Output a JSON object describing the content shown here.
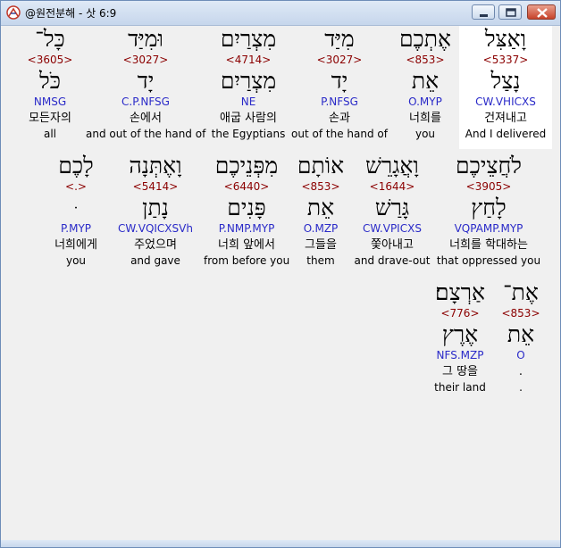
{
  "window": {
    "title": "@원전분해 - 삿 6:9",
    "controls": {
      "minimize": "minimize-icon",
      "maximize": "maximize-icon",
      "close": "close-icon"
    }
  },
  "rows": [
    [
      {
        "hebrew": "וָאַצִּל",
        "strong": "<5337>",
        "lemma": "נָצַל",
        "morph": "CW.VHICXS",
        "korean": "건져내고",
        "english": "And I delivered",
        "highlight": true
      },
      {
        "hebrew": "אֶתְכֶם",
        "strong": "<853>",
        "lemma": "אֵת",
        "morph": "O.MYP",
        "korean": "너희를",
        "english": "you"
      },
      {
        "hebrew": "מִיַּד",
        "strong": "<3027>",
        "lemma": "יָד",
        "morph": "P.NFSG",
        "korean": "손과",
        "english": "out of the hand of"
      },
      {
        "hebrew": "מִצְרַיִם",
        "strong": "<4714>",
        "lemma": "מִצְרַיִם",
        "morph": "NE",
        "korean": "애굽 사람의",
        "english": "the Egyptians"
      },
      {
        "hebrew": "וּמִיַּד",
        "strong": "<3027>",
        "lemma": "יָד",
        "morph": "C.P.NFSG",
        "korean": "손에서",
        "english": "and out of the hand of"
      },
      {
        "hebrew": "כָּל־",
        "strong": "<3605>",
        "lemma": "כֹּל",
        "morph": "NMSG",
        "korean": "모든자의",
        "english": "all"
      }
    ],
    [
      {
        "hebrew": "לֹחֲצֵיכֶם",
        "strong": "<3905>",
        "lemma": "לָחַץ",
        "morph": "VQPAMP.MYP",
        "korean": "너희를 학대하는",
        "english": "that oppressed you"
      },
      {
        "hebrew": "וָאֲגָרֵשׁ",
        "strong": "<1644>",
        "lemma": "גָּרַשׁ",
        "morph": "CW.VPICXS",
        "korean": "쫓아내고",
        "english": "and drave-out"
      },
      {
        "hebrew": "אוֹתָם",
        "strong": "<853>",
        "lemma": "אֵת",
        "morph": "O.MZP",
        "korean": "그들을",
        "english": "them"
      },
      {
        "hebrew": "מִפְּנֵיכֶם",
        "strong": "<6440>",
        "lemma": "פָּנִים",
        "morph": "P.NMP.MYP",
        "korean": "너희 앞에서",
        "english": "from before you"
      },
      {
        "hebrew": "וָאֶתְּנָה",
        "strong": "<5414>",
        "lemma": "נָתַן",
        "morph": "CW.VQICXSVh",
        "korean": "주었으며",
        "english": "and gave"
      },
      {
        "hebrew": "לָכֶם",
        "strong": "<.>",
        "lemma": "ּ",
        "morph": "P.MYP",
        "korean": "너희에게",
        "english": "you"
      }
    ],
    [
      {
        "hebrew": "אֶת־",
        "strong": "<853>",
        "lemma": "אֵת",
        "morph": "O",
        "korean": ".",
        "english": "."
      },
      {
        "hebrew": "אַרְצָם׃",
        "strong": "<776>",
        "lemma": "אֶרֶץ",
        "morph": "NFS.MZP",
        "korean": "그 땅을",
        "english": "their land"
      }
    ]
  ]
}
